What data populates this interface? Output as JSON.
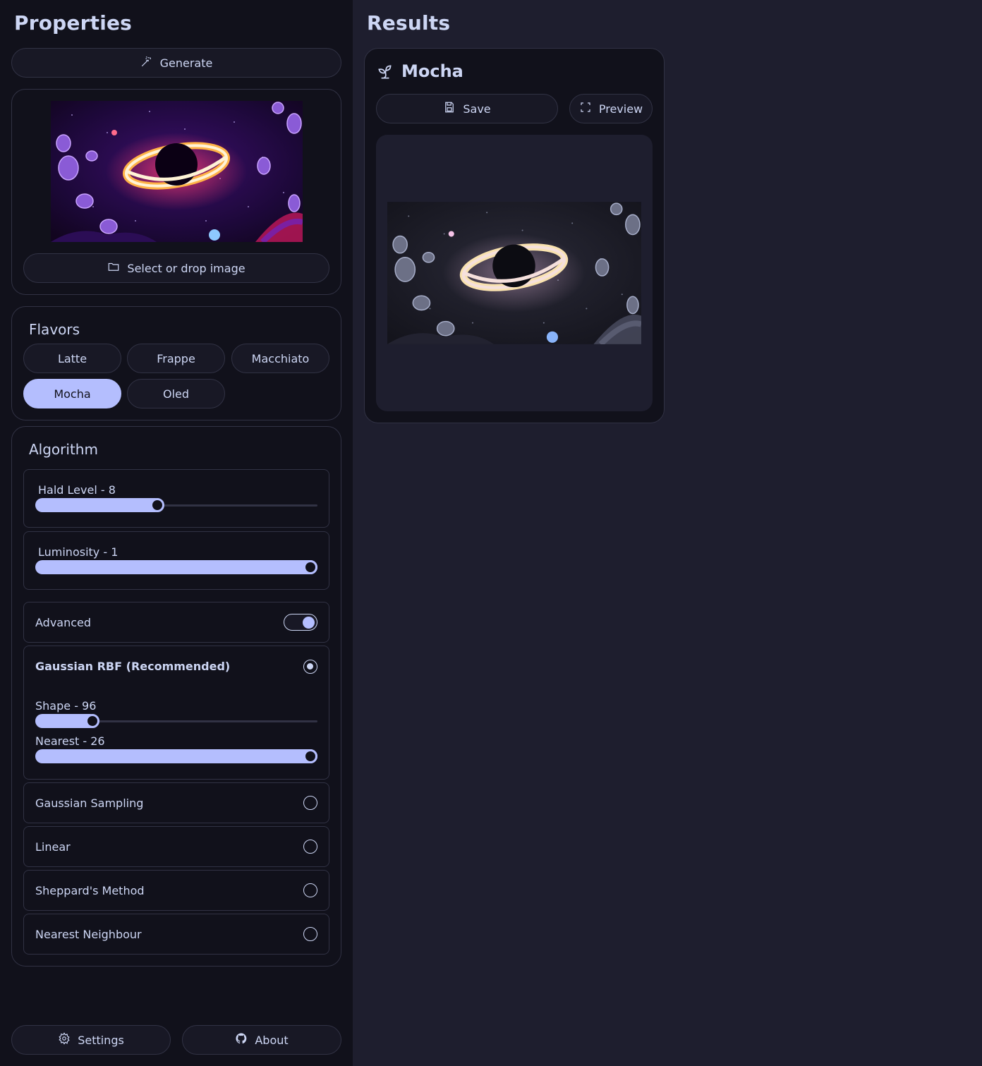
{
  "sidebar": {
    "title": "Properties",
    "generate_label": "Generate",
    "select_image_label": "Select or drop image",
    "flavors": {
      "title": "Flavors",
      "items": [
        {
          "label": "Latte",
          "active": false
        },
        {
          "label": "Frappe",
          "active": false
        },
        {
          "label": "Macchiato",
          "active": false
        },
        {
          "label": "Mocha",
          "active": true
        },
        {
          "label": "Oled",
          "active": false
        }
      ]
    },
    "algorithm": {
      "title": "Algorithm",
      "hald_level": {
        "label": "Hald Level - 8",
        "value": 8
      },
      "luminosity": {
        "label": "Luminosity - 1",
        "value": 1
      },
      "advanced": {
        "label": "Advanced",
        "enabled": true
      },
      "options": [
        {
          "label": "Gaussian RBF (Recommended)",
          "selected": true
        },
        {
          "label": "Gaussian Sampling",
          "selected": false
        },
        {
          "label": "Linear",
          "selected": false
        },
        {
          "label": "Sheppard's Method",
          "selected": false
        },
        {
          "label": "Nearest Neighbour",
          "selected": false
        }
      ],
      "shape": {
        "label": "Shape - 96",
        "value": 96
      },
      "nearest": {
        "label": "Nearest - 26",
        "value": 26
      }
    },
    "settings_label": "Settings",
    "about_label": "About"
  },
  "main": {
    "title": "Results",
    "result": {
      "name": "Mocha",
      "save_label": "Save",
      "preview_label": "Preview"
    }
  },
  "icons": {
    "generate": "magic-wand-icon",
    "select": "folder-icon",
    "settings": "gear-icon",
    "about": "github-icon",
    "result": "plant-icon",
    "save": "floppy-disk-icon",
    "preview": "expand-icon"
  },
  "colors": {
    "accent": "#b4befe",
    "base": "#1e1e2e",
    "crust": "#11111b",
    "mantle": "#181825",
    "surface": "#313244",
    "text": "#cdd6f4"
  }
}
